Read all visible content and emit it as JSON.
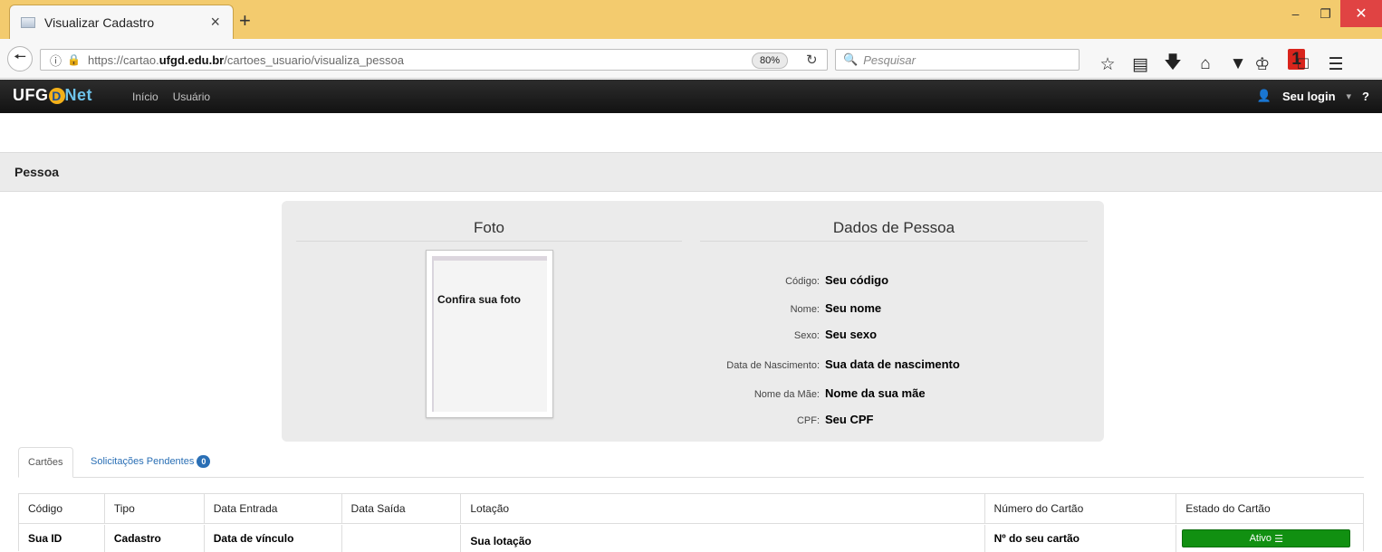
{
  "browser": {
    "tab_title": "Visualizar Cadastro",
    "tab_close_glyph": "×",
    "new_tab_glyph": "+",
    "url_host_prefix": "https://cartao.",
    "url_host_bold": "ufgd.edu.br",
    "url_path": "/cartoes_usuario/visualiza_pessoa",
    "zoom": "80%",
    "search_placeholder": "Pesquisar",
    "notification_count": "1"
  },
  "app": {
    "logo_left": "UFG",
    "logo_mid": "D",
    "logo_right": "Net",
    "nav": [
      "Início",
      "Usuário"
    ],
    "user_label": "Seu login",
    "help_label": "?"
  },
  "page": {
    "section_title": "Pessoa",
    "photo_heading": "Foto",
    "photo_caption": "Confira sua foto",
    "data_heading": "Dados de Pessoa",
    "fields": [
      {
        "label": "Código:",
        "value": "Seu código"
      },
      {
        "label": "Nome:",
        "value": "Seu nome"
      },
      {
        "label": "Sexo:",
        "value": "Seu sexo"
      },
      {
        "label": "Data de Nascimento:",
        "value": "Sua data de nascimento"
      },
      {
        "label": "Nome da Mãe:",
        "value": "Nome da sua mãe"
      },
      {
        "label": "CPF:",
        "value": "Seu CPF"
      }
    ],
    "tabs": {
      "cards_label": "Cartões",
      "pending_label": "Solicitações Pendentes",
      "pending_count": "0"
    },
    "table": {
      "headers": [
        "Código",
        "Tipo",
        "Data Entrada",
        "Data Saída",
        "Lotação",
        "Número do Cartão",
        "Estado do Cartão"
      ],
      "row": [
        "Sua ID",
        "Cadastro",
        "Data de vínculo",
        "",
        "Sua lotação",
        "Nº do seu cartão"
      ],
      "status": "Ativo"
    }
  },
  "colors": {
    "tabbar": "#f3cb6e",
    "appbar": "#1a1a1a",
    "status_active": "#119011",
    "link": "#2a6fb5"
  }
}
